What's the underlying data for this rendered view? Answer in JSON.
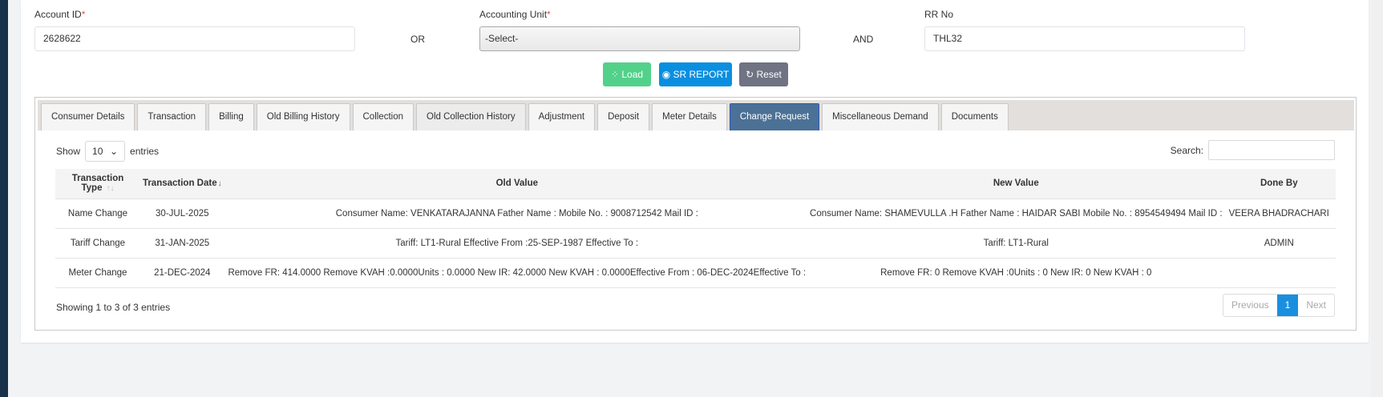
{
  "form": {
    "account_id_label": "Account ID",
    "required_mark": "*",
    "account_id_value": "2628622",
    "or_label": "OR",
    "accounting_unit_label": "Accounting Unit",
    "accounting_unit_value": "-Select-",
    "and_label": "AND",
    "rr_no_label": "RR No",
    "rr_no_value": "THL32"
  },
  "buttons": {
    "load": "Load",
    "sr_report": "SR REPORT",
    "reset": "Reset"
  },
  "colors": {
    "load": "#52d18a",
    "sr_report": "#0a8fe0",
    "reset": "#6f7383",
    "active_tab": "#4c7196"
  },
  "tabs": [
    "Consumer Details",
    "Transaction",
    "Billing",
    "Old Billing History",
    "Collection",
    "Old Collection History",
    "Adjustment",
    "Deposit",
    "Meter Details",
    "Change Request",
    "Miscellaneous Demand",
    "Documents"
  ],
  "table_controls": {
    "show": "Show",
    "entries_value": "10",
    "entries": "entries",
    "search_label": "Search:"
  },
  "table": {
    "headers": [
      "Transaction Type",
      "Transaction Date",
      "Old Value",
      "New Value",
      "Done By"
    ],
    "rows": [
      [
        "Name Change",
        "30-JUL-2025",
        "Consumer Name: VENKATARAJANNA Father Name : Mobile No. : 9008712542 Mail ID :",
        "Consumer Name: SHAMEVULLA .H Father Name : HAIDAR SABI Mobile No. : 8954549494 Mail ID :",
        "VEERA BHADRACHARI"
      ],
      [
        "Tariff Change",
        "31-JAN-2025",
        "Tariff: LT1-Rural Effective From :25-SEP-1987 Effective To :",
        "Tariff: LT1-Rural",
        "ADMIN"
      ],
      [
        "Meter Change",
        "21-DEC-2024",
        "Remove FR: 414.0000 Remove KVAH :0.0000Units : 0.0000 New IR: 42.0000 New KVAH : 0.0000Effective From : 06-DEC-2024Effective To :",
        "Remove FR: 0 Remove KVAH :0Units : 0 New IR: 0 New KVAH : 0",
        ""
      ]
    ]
  },
  "footer": {
    "info": "Showing 1 to 3 of 3 entries",
    "previous": "Previous",
    "page": "1",
    "next": "Next"
  }
}
